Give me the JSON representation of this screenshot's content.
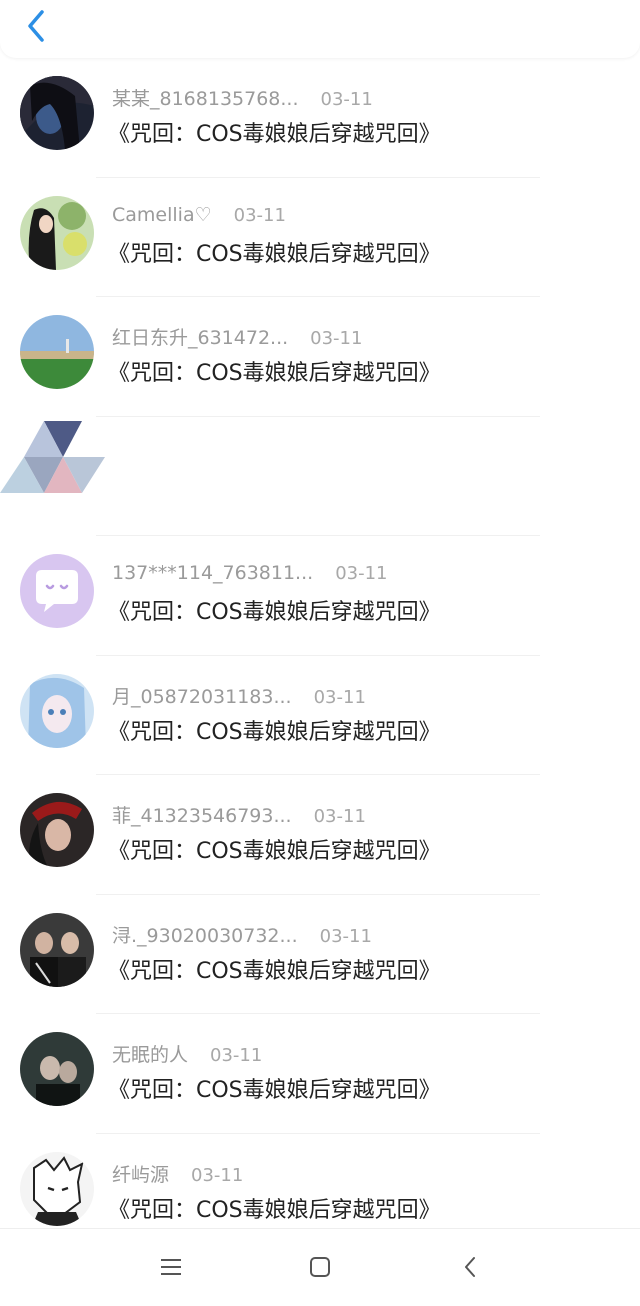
{
  "header": {
    "back_icon": "chevron-left-icon",
    "accent": "#2c8fe5"
  },
  "rows": [
    {
      "name": "某某_8168135768...",
      "date": "03-11",
      "message": "《咒回：COS毒娘娘后穿越咒回》"
    },
    {
      "name": "Camellia♡",
      "date": "03-11",
      "message": "《咒回：COS毒娘娘后穿越咒回》"
    },
    {
      "name": "红日东升_631472...",
      "date": "03-11",
      "message": "《咒回：COS毒娘娘后穿越咒回》"
    },
    {
      "name": "",
      "date": "",
      "message": ""
    },
    {
      "name": "137***114_763811...",
      "date": "03-11",
      "message": "《咒回：COS毒娘娘后穿越咒回》"
    },
    {
      "name": "月_05872031183...",
      "date": "03-11",
      "message": "《咒回：COS毒娘娘后穿越咒回》"
    },
    {
      "name": "菲_41323546793...",
      "date": "03-11",
      "message": "《咒回：COS毒娘娘后穿越咒回》"
    },
    {
      "name": "浔._93020030732...",
      "date": "03-11",
      "message": "《咒回：COS毒娘娘后穿越咒回》"
    },
    {
      "name": "无眠的人",
      "date": "03-11",
      "message": "《咒回：COS毒娘娘后穿越咒回》"
    },
    {
      "name": "纤屿源",
      "date": "03-11",
      "message": "《咒回：COS毒娘娘后穿越咒回》"
    }
  ],
  "navbar": {
    "menu_icon": "menu-icon",
    "home_icon": "home-square-icon",
    "back_icon": "back-icon"
  }
}
